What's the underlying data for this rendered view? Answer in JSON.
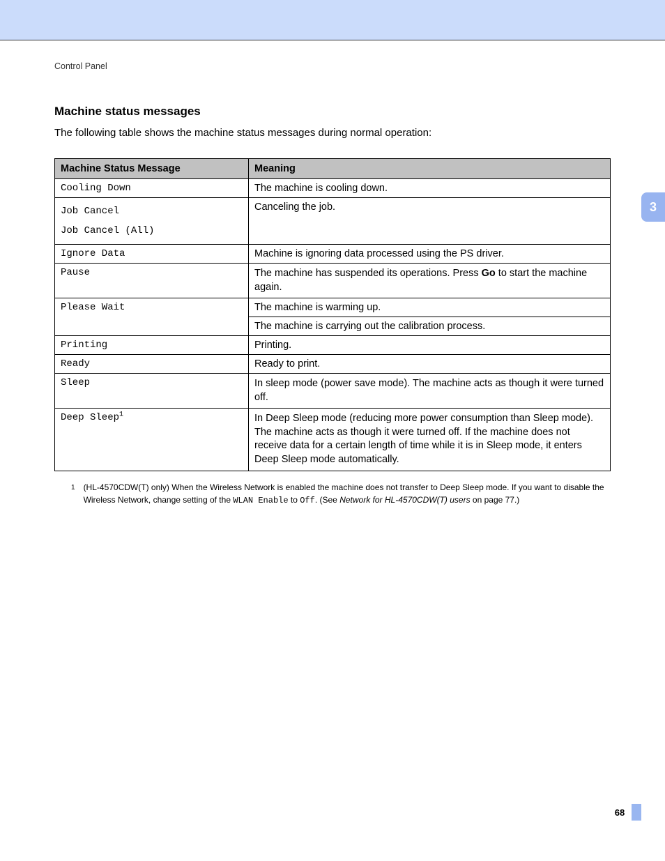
{
  "breadcrumb": "Control Panel",
  "section_title": "Machine status messages",
  "intro": "The following table shows the machine status messages during normal operation:",
  "table": {
    "header_col1": "Machine Status Message",
    "header_col2": "Meaning",
    "rows": {
      "r1_msg": "Cooling Down",
      "r1_mean": "The machine is cooling down.",
      "r2a_msg": "Job Cancel",
      "r2a_mean": "Canceling the job.",
      "r2b_msg": "Job Cancel (All)",
      "r3_msg": "Ignore Data",
      "r3_mean": "Machine is ignoring data processed using the PS driver.",
      "r4_msg": "Pause",
      "r4_mean_pre": "The machine has suspended its operations. Press ",
      "r4_mean_bold": "Go",
      "r4_mean_post": " to start the machine again.",
      "r5_msg": "Please Wait",
      "r5a_mean": "The machine is warming up.",
      "r5b_mean": "The machine is carrying out the calibration process.",
      "r6_msg": "Printing",
      "r6_mean": "Printing.",
      "r7_msg": "Ready",
      "r7_mean": "Ready to print.",
      "r8_msg": "Sleep",
      "r8_mean": "In sleep mode (power save mode). The machine acts as though it were turned off.",
      "r9_msg": "Deep Sleep",
      "r9_sup": "1",
      "r9_mean": "In Deep Sleep mode (reducing more power consumption than Sleep mode). The machine acts as though it were turned off. If the machine does not receive data for a certain length of time while it is in Sleep mode, it enters Deep Sleep mode automatically."
    }
  },
  "footnote": {
    "marker": "1",
    "text_pre": "(HL-4570CDW(T) only) When the Wireless Network is enabled the machine does not transfer to Deep Sleep mode. If you want to disable the Wireless Network, change setting of the ",
    "mono1": "WLAN Enable",
    "mid": " to ",
    "mono2": "Off",
    "post1": ". (See ",
    "italic": "Network for HL-4570CDW(T) users",
    "post2": " on page 77.)"
  },
  "side_tab": "3",
  "page_number": "68"
}
